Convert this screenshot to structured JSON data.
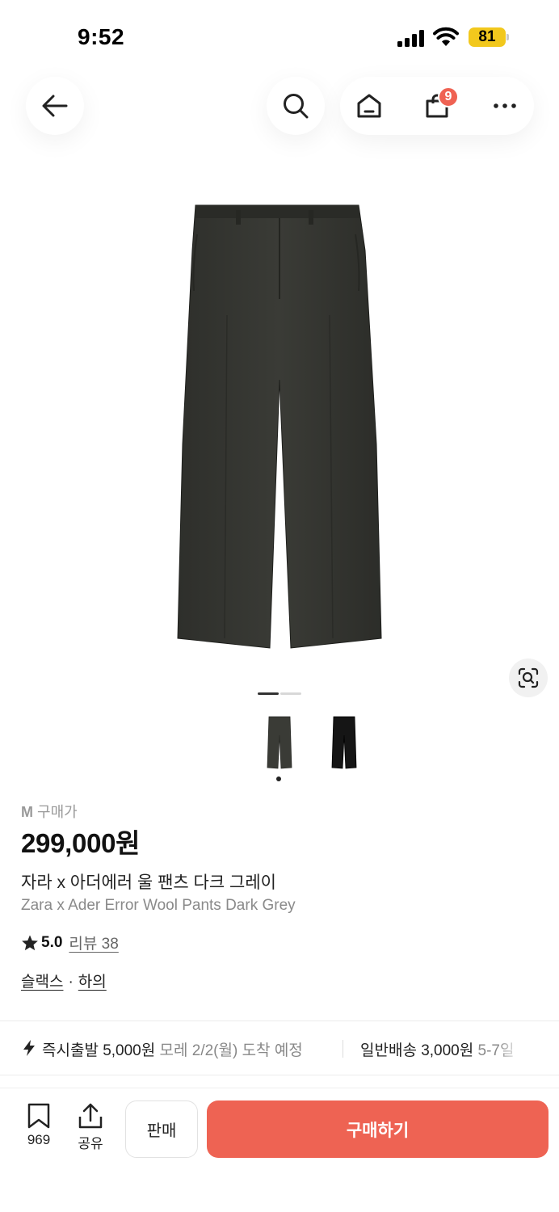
{
  "status_bar": {
    "time": "9:52",
    "battery": "81"
  },
  "nav": {
    "icons": [
      "back-arrow-icon",
      "search-icon",
      "home-icon",
      "shopping-bag-icon",
      "more-icon"
    ],
    "cart_badge": "9"
  },
  "gallery": {
    "pages": 2,
    "current_page": 1,
    "thumbnails": [
      "dark-grey-pants",
      "black-pants"
    ],
    "selected_thumbnail": 0
  },
  "product": {
    "size_label": "M",
    "price_type": "구매가",
    "price": "299,000원",
    "title_ko": "자라 x 아더에러 울 팬츠 다크 그레이",
    "title_en": "Zara x Ader Error Wool Pants Dark Grey",
    "rating": "5.0",
    "review_label": "리뷰 38",
    "category_1": "슬랙스",
    "category_sep": "·",
    "category_2": "하의"
  },
  "shipping": {
    "express_label": "즉시출발 5,000원",
    "express_eta": "모레 2/2(월) 도착 예정",
    "standard_label": "일반배송 3,000원",
    "standard_eta": "5-7일"
  },
  "bottom_bar": {
    "bookmark_count": "969",
    "share_label": "공유",
    "sell_label": "판매",
    "buy_label": "구매하기"
  },
  "colors": {
    "accent": "#ee6353",
    "badge": "#ef6253",
    "battery": "#f2c81d"
  }
}
